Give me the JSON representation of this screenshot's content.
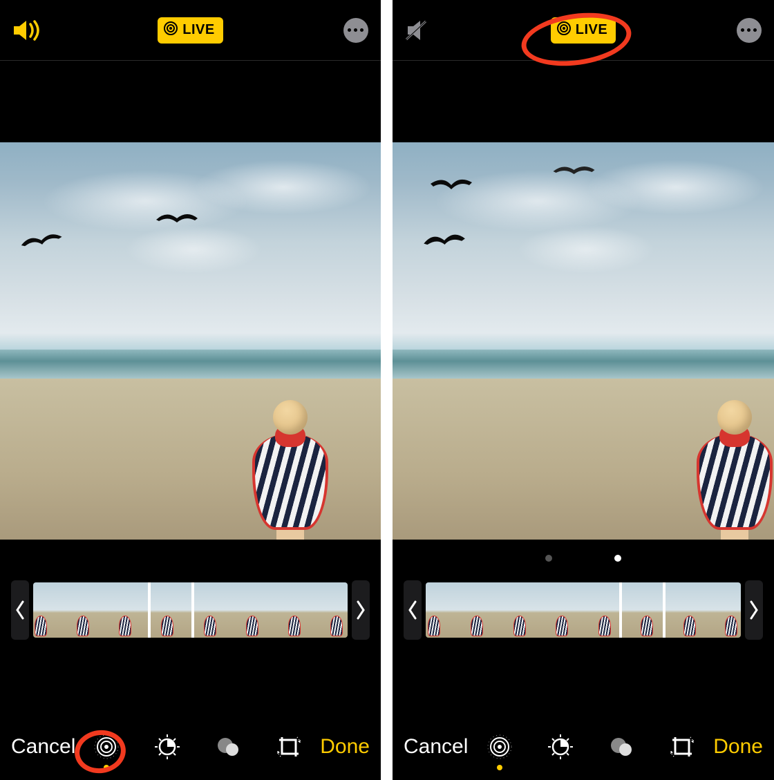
{
  "colors": {
    "accent": "#ffcc00",
    "annotation": "#F23A1F"
  },
  "left": {
    "top": {
      "sound": "on",
      "live_label": "LIVE"
    },
    "filmstrip": {
      "frame_count": 8,
      "selected_index": 3,
      "child_positions": [
        4,
        10,
        18,
        26,
        34,
        42,
        48,
        56
      ]
    },
    "toolbar": {
      "cancel_label": "Cancel",
      "done_label": "Done",
      "tools": [
        "live",
        "adjust",
        "filters",
        "crop"
      ],
      "active_tool": "live"
    },
    "annotation": "live-tool"
  },
  "right": {
    "top": {
      "sound": "muted",
      "live_label": "LIVE"
    },
    "filmstrip": {
      "frame_count": 8,
      "selected_index": 5,
      "child_positions": [
        6,
        14,
        22,
        30,
        38,
        46,
        54,
        60
      ],
      "page_dots": true,
      "active_dot": 1
    },
    "toolbar": {
      "cancel_label": "Cancel",
      "done_label": "Done",
      "tools": [
        "live",
        "adjust",
        "filters",
        "crop"
      ],
      "active_tool": "live"
    },
    "annotation": "live-badge"
  }
}
